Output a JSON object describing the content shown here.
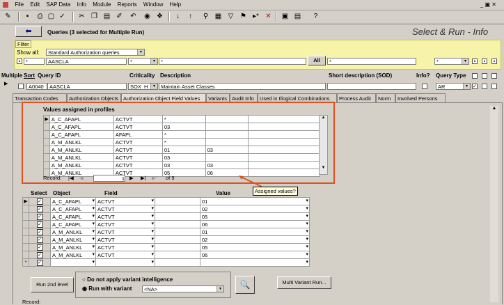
{
  "menu": {
    "file": "File",
    "edit": "Edit",
    "sap_data": "SAP Data",
    "info": "Info",
    "module": "Module",
    "reports": "Reports",
    "window": "Window",
    "help": "Help"
  },
  "header": {
    "queries": "Queries (3 selected for Multiple Run)",
    "app_title": "Select & Run  - Info"
  },
  "filter": {
    "label": "Filter",
    "show_all": "Show all:",
    "show_all_value": "Standard Authorization queries",
    "field1": "*",
    "field2": "AASCLA",
    "field3": "*",
    "field4": "*",
    "all_button": "All",
    "field5": "*",
    "field6": "*"
  },
  "columns": {
    "multiple": "Multiple",
    "sort": "Sort",
    "query_id": "Query ID",
    "criticality": "Criticality",
    "description": "Description",
    "short_desc": "Short description (SOD)",
    "info": "Info?",
    "query_type": "Query Type"
  },
  "row": {
    "num": "A0040",
    "query_id": "AASCLA",
    "criticality": "SOX_H",
    "description": "Maintain Asset Classes",
    "query_type": "AR"
  },
  "tabs": [
    "Transaction Codes",
    "Authorization Objects",
    "Authorization Object Field Values",
    "Variants",
    "Audit Info",
    "Used in Illogical Combinations",
    "Process Audit",
    "Norm",
    "Involved Persons"
  ],
  "profiles": {
    "title": "Values assigned in profiles",
    "rows": [
      [
        "A_C_AFAPL",
        "ACTVT",
        "*",
        ""
      ],
      [
        "A_C_AFAPL",
        "ACTVT",
        "03",
        ""
      ],
      [
        "A_C_AFAPL",
        "AFAPL",
        "*",
        ""
      ],
      [
        "A_M_ANLKL",
        "ACTVT",
        "*",
        ""
      ],
      [
        "A_M_ANLKL",
        "ACTVT",
        "01",
        "03"
      ],
      [
        "A_M_ANLKL",
        "ACTVT",
        "03",
        ""
      ],
      [
        "A_M_ANLKL",
        "ACTVT",
        "03",
        "03"
      ],
      [
        "A_M_ANLKL",
        "ACTVT",
        "05",
        "06"
      ]
    ],
    "record_label": "Record:",
    "record_value": "1",
    "record_of": "of  9"
  },
  "tooltip": "Assigned values?",
  "lower": {
    "headers": {
      "select": "Select",
      "object": "Object",
      "field": "Field",
      "value": "Value"
    },
    "rows": [
      [
        "A_C_AFAPL",
        "ACTVT",
        "01"
      ],
      [
        "A_C_AFAPL",
        "ACTVT",
        "02"
      ],
      [
        "A_C_AFAPL",
        "ACTVT",
        "05"
      ],
      [
        "A_C_AFAPL",
        "ACTVT",
        "06"
      ],
      [
        "A_M_ANLKL",
        "ACTVT",
        "01"
      ],
      [
        "A_M_ANLKL",
        "ACTVT",
        "02"
      ],
      [
        "A_M_ANLKL",
        "ACTVT",
        "05"
      ],
      [
        "A_M_ANLKL",
        "ACTVT",
        "06"
      ]
    ]
  },
  "bottom": {
    "run_2nd": "Run 2nd level",
    "no_variant": "Do not apply variant intelligence",
    "run_variant": "Run with variant",
    "variant_value": "<NA>",
    "multi_variant": "Multi Variant Run...",
    "record": "Record:"
  }
}
